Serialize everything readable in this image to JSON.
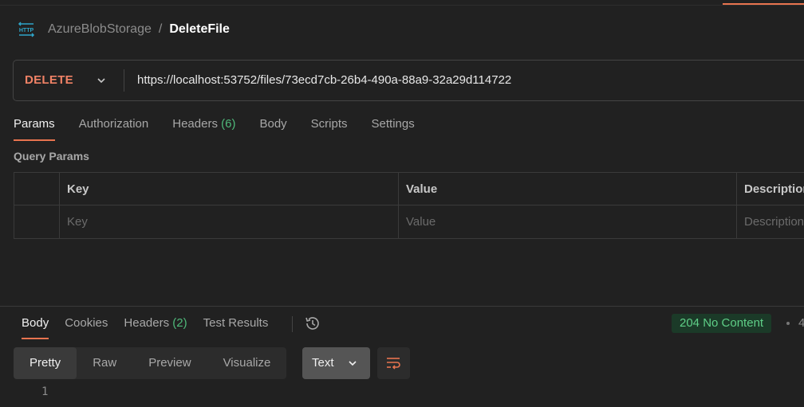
{
  "breadcrumb": {
    "icon": "http-icon",
    "collection": "AzureBlobStorage",
    "separator": "/",
    "request": "DeleteFile"
  },
  "request": {
    "method": "DELETE",
    "url": "https://localhost:53752/files/73ecd7cb-26b4-490a-88a9-32a29d114722"
  },
  "request_tabs": [
    {
      "label": "Params",
      "active": true
    },
    {
      "label": "Authorization"
    },
    {
      "label": "Headers",
      "count": "(6)"
    },
    {
      "label": "Body"
    },
    {
      "label": "Scripts"
    },
    {
      "label": "Settings"
    }
  ],
  "query_params": {
    "title": "Query Params",
    "columns": [
      "Key",
      "Value",
      "Description"
    ],
    "placeholders": [
      "Key",
      "Value",
      "Description"
    ]
  },
  "response_tabs": [
    {
      "label": "Body",
      "active": true
    },
    {
      "label": "Cookies"
    },
    {
      "label": "Headers",
      "count": "(2)"
    },
    {
      "label": "Test Results"
    }
  ],
  "response": {
    "status": "204 No Content",
    "trailing": "4"
  },
  "format_tabs": [
    {
      "label": "Pretty",
      "active": true
    },
    {
      "label": "Raw"
    },
    {
      "label": "Preview"
    },
    {
      "label": "Visualize"
    }
  ],
  "format_type": "Text",
  "line_numbers": [
    "1"
  ],
  "colors": {
    "accent": "#e8744f",
    "method_delete": "#f08266",
    "count_green": "#4fb97a",
    "status_green": "#5fcf87"
  }
}
